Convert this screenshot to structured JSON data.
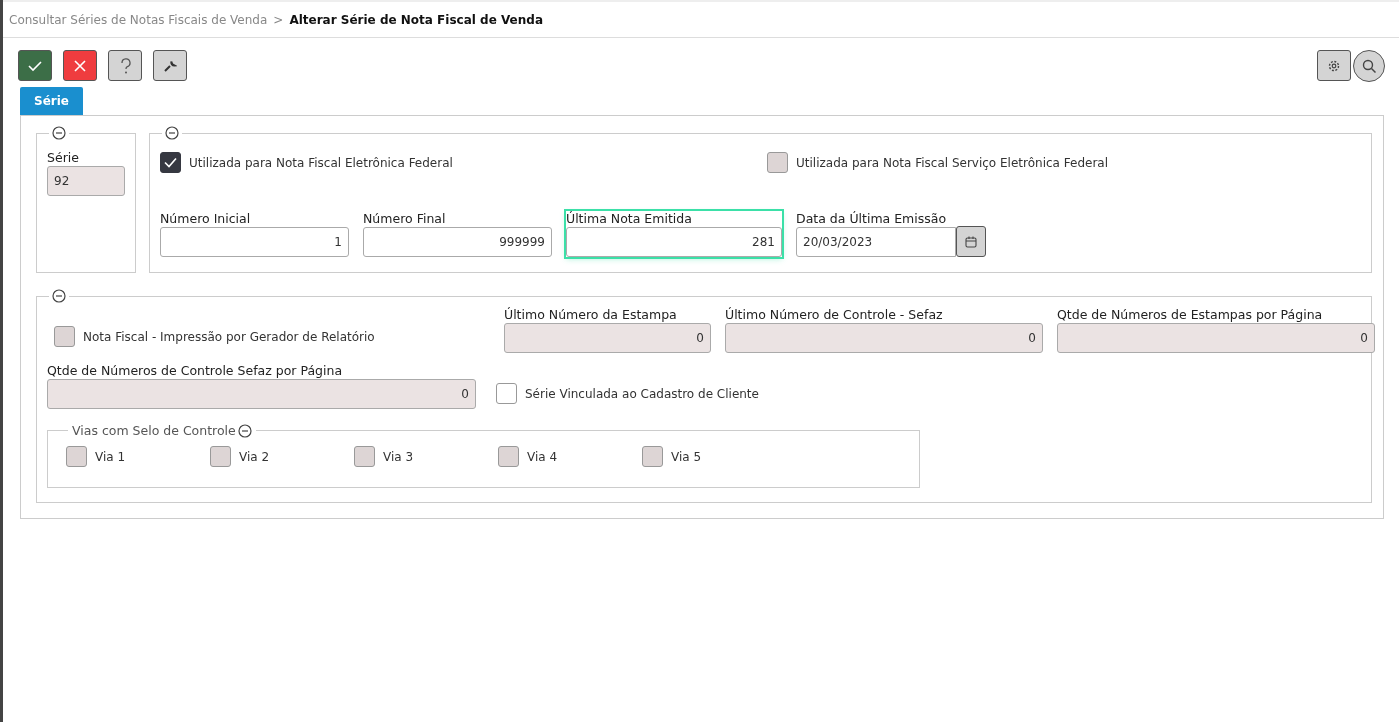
{
  "breadcrumb": {
    "parent": "Consultar Séries de Notas Fiscais de Venda",
    "separator": ">",
    "current": "Alterar Série de Nota Fiscal de Venda"
  },
  "toolbar": [
    {
      "kind": "confirm"
    },
    {
      "kind": "cancel"
    },
    {
      "kind": "help"
    },
    {
      "kind": "tools"
    }
  ],
  "toolbar_right": [
    {
      "kind": "settings"
    },
    {
      "kind": "search"
    }
  ],
  "tabs": [
    {
      "label": "Série",
      "selected": true
    }
  ],
  "serie_section": {
    "expanded": true,
    "field": {
      "label": "Série",
      "value": "92",
      "disabled": true,
      "focused": false
    }
  },
  "nfe_section": {
    "expanded": true,
    "checkboxes": [
      {
        "label": "Utilizada para Nota Fiscal Eletrônica Federal",
        "checked": true,
        "disabled": false
      },
      {
        "label": "Utilizada para Nota Fiscal Serviço Eletrônica Federal",
        "checked": false,
        "disabled": true
      }
    ],
    "fields": [
      {
        "kind": "number",
        "label": "Número Inicial",
        "value": "1",
        "disabled": false,
        "focused": false
      },
      {
        "kind": "number",
        "label": "Número Final",
        "value": "999999",
        "disabled": false,
        "focused": false
      },
      {
        "kind": "number",
        "label": "Última Nota Emitida",
        "value": "281",
        "disabled": false,
        "focused": true
      },
      {
        "kind": "date",
        "label": "Data da Última Emissão",
        "value": "20/03/2023",
        "disabled": false,
        "focused": false
      }
    ]
  },
  "print_section": {
    "expanded": true,
    "report_checkbox": {
      "label": "Nota Fiscal - Impressão por Gerador de Relatório",
      "checked": false,
      "disabled": true
    },
    "fields": [
      {
        "label": "Último Número da Estampa",
        "value": "0",
        "disabled": true,
        "focused": false
      },
      {
        "label": "Último Número de Controle - Sefaz",
        "value": "0",
        "disabled": true,
        "focused": false
      },
      {
        "label": "Qtde de Números de Estampas por Página",
        "value": "0",
        "disabled": true,
        "focused": false
      }
    ],
    "sefaz_field": {
      "label": "Qtde de Números de Controle Sefaz por Página",
      "value": "0",
      "disabled": true,
      "focused": false
    },
    "client_checkbox": {
      "label": "Série Vinculada ao Cadastro de Cliente",
      "checked": false,
      "disabled": false
    },
    "vias": {
      "legend": "Vias com Selo de Controle",
      "expanded": true,
      "items": [
        {
          "label": "Via 1",
          "checked": false,
          "disabled": true
        },
        {
          "label": "Via 2",
          "checked": false,
          "disabled": true
        },
        {
          "label": "Via 3",
          "checked": false,
          "disabled": true
        },
        {
          "label": "Via 4",
          "checked": false,
          "disabled": true
        },
        {
          "label": "Via 5",
          "checked": false,
          "disabled": true
        }
      ]
    }
  }
}
